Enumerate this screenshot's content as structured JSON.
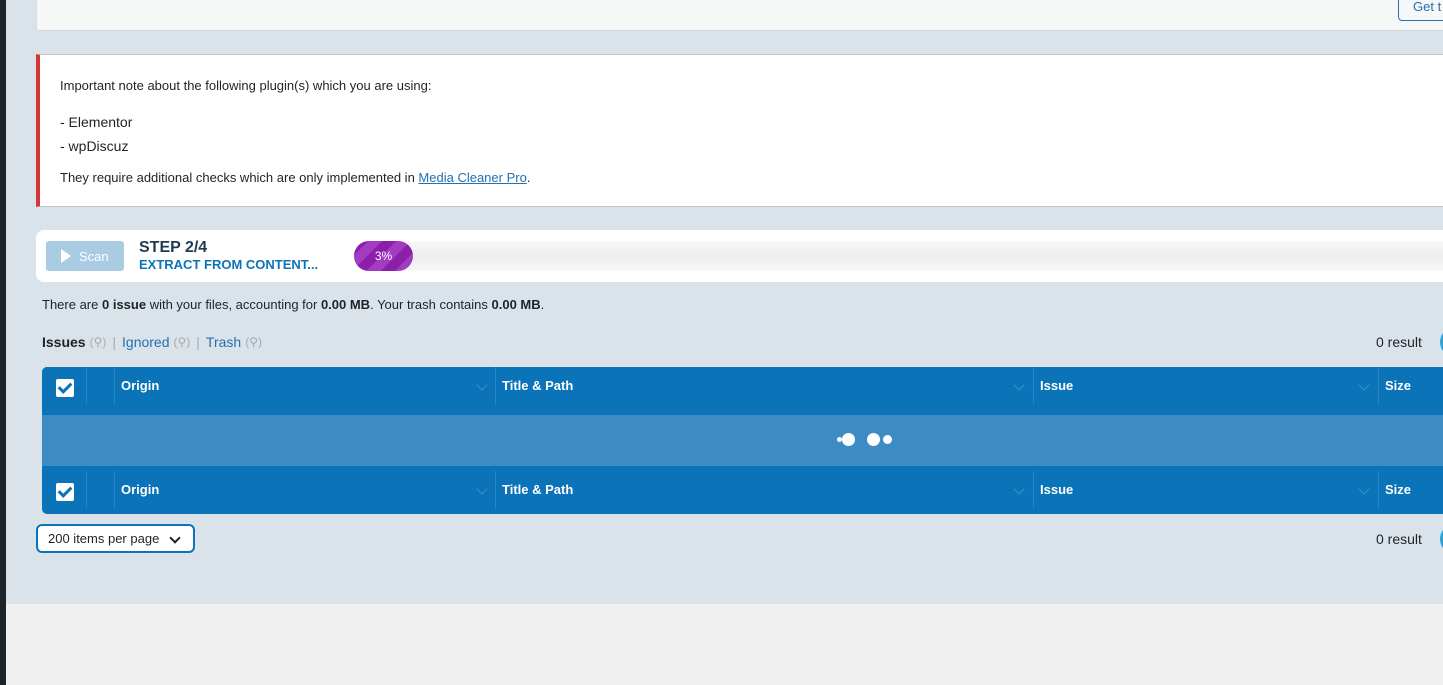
{
  "header": {
    "get_button_label": "Get t"
  },
  "notice": {
    "intro": "Important note about the following plugin(s) which you are using:",
    "plugins": [
      "- Elementor",
      "- wpDiscuz"
    ],
    "outro_before": "They require additional checks which are only implemented in ",
    "link_label": "Media Cleaner Pro",
    "outro_after": "."
  },
  "scan": {
    "button_label": "Scan",
    "step_title": "STEP 2/4",
    "step_subtitle": "EXTRACT FROM CONTENT...",
    "progress_label": "3%",
    "progress_fraction": 0.053
  },
  "summary": {
    "t1": "There are ",
    "issues": "0 issue",
    "t2": " with your files, accounting for ",
    "size": "0.00 MB",
    "t3": ". Your trash contains ",
    "trash": "0.00 MB",
    "t4": "."
  },
  "filters": {
    "issues_label": "Issues",
    "ignored_label": "Ignored",
    "trash_label": "Trash",
    "count_placeholder": "(⚲)",
    "separator": "|"
  },
  "result_count": "0 result",
  "table": {
    "columns": [
      "Origin",
      "Title & Path",
      "Issue",
      "Size"
    ]
  },
  "pagination": {
    "per_page": "200 items per page"
  },
  "colors": {
    "primary": "#0b74b8",
    "progress": "#8b1fa9",
    "notice_border": "#d63638"
  }
}
